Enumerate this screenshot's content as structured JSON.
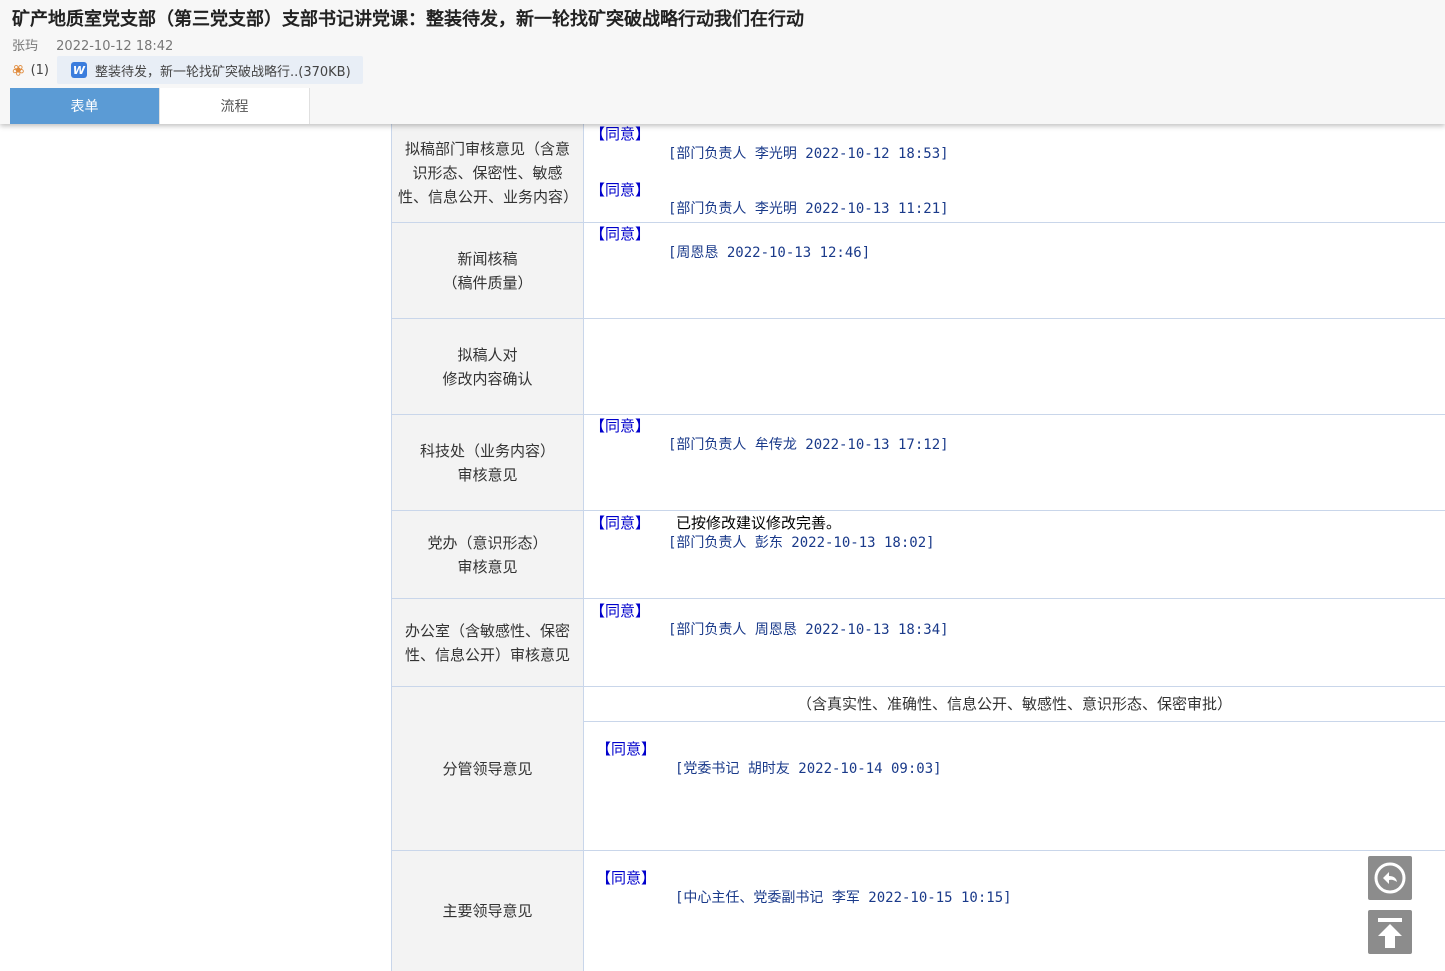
{
  "doc": {
    "title": "矿产地质室党支部（第三党支部）支部书记讲党课：整装待发，新一轮找矿突破战略行动我们在行动",
    "author": "张玙",
    "datetime": "2022-10-12 18:42"
  },
  "attachment": {
    "count": "(1)",
    "file_name": "整装待发，新一轮找矿突破战略行..(370KB)",
    "icon": "word-doc-icon"
  },
  "tabs": [
    {
      "label": "表单",
      "active": true
    },
    {
      "label": "流程",
      "active": false
    }
  ],
  "rows": [
    {
      "label": "拟稿部门审核意见（含意识形态、保密性、敏感性、信息公开、业务内容）",
      "entries": [
        {
          "agree": "【同意】",
          "sig": "[部门负责人 李光明 2022-10-12 18:53]"
        },
        {
          "agree": "【同意】",
          "sig": "[部门负责人 李光明 2022-10-13 11:21]"
        }
      ]
    },
    {
      "label": "新闻核稿\n（稿件质量）",
      "entries": [
        {
          "agree": "【同意】",
          "sig": "[周恩恳 2022-10-13 12:46]"
        }
      ]
    },
    {
      "label": "拟稿人对\n修改内容确认",
      "entries": []
    },
    {
      "label": "科技处（业务内容）\n审核意见",
      "entries": [
        {
          "agree": "【同意】",
          "sig": "[部门负责人 牟传龙 2022-10-13 17:12]"
        }
      ]
    },
    {
      "label": "党办（意识形态）\n审核意见",
      "entries": [
        {
          "agree": "【同意】",
          "note": "已按修改建议修改完善。",
          "sig": "[部门负责人 彭东 2022-10-13 18:02]"
        }
      ]
    },
    {
      "label": "办公室（含敏感性、保密性、信息公开）审核意见",
      "entries": [
        {
          "agree": "【同意】",
          "sig": "[部门负责人 周恩恳 2022-10-13 18:34]"
        }
      ]
    },
    {
      "label": "分管领导意见",
      "sub_head": "（含真实性、准确性、信息公开、敏感性、意识形态、保密审批）",
      "entries": [
        {
          "agree": "【同意】",
          "sig": "[党委书记 胡时友 2022-10-14 09:03]"
        }
      ]
    },
    {
      "label": "主要领导意见",
      "entries": [
        {
          "agree": "【同意】",
          "sig": "[中心主任、党委副书记 李军 2022-10-15 10:15]"
        }
      ]
    }
  ],
  "floating": {
    "reply_icon": "reply-icon",
    "top_icon": "back-to-top-icon"
  }
}
